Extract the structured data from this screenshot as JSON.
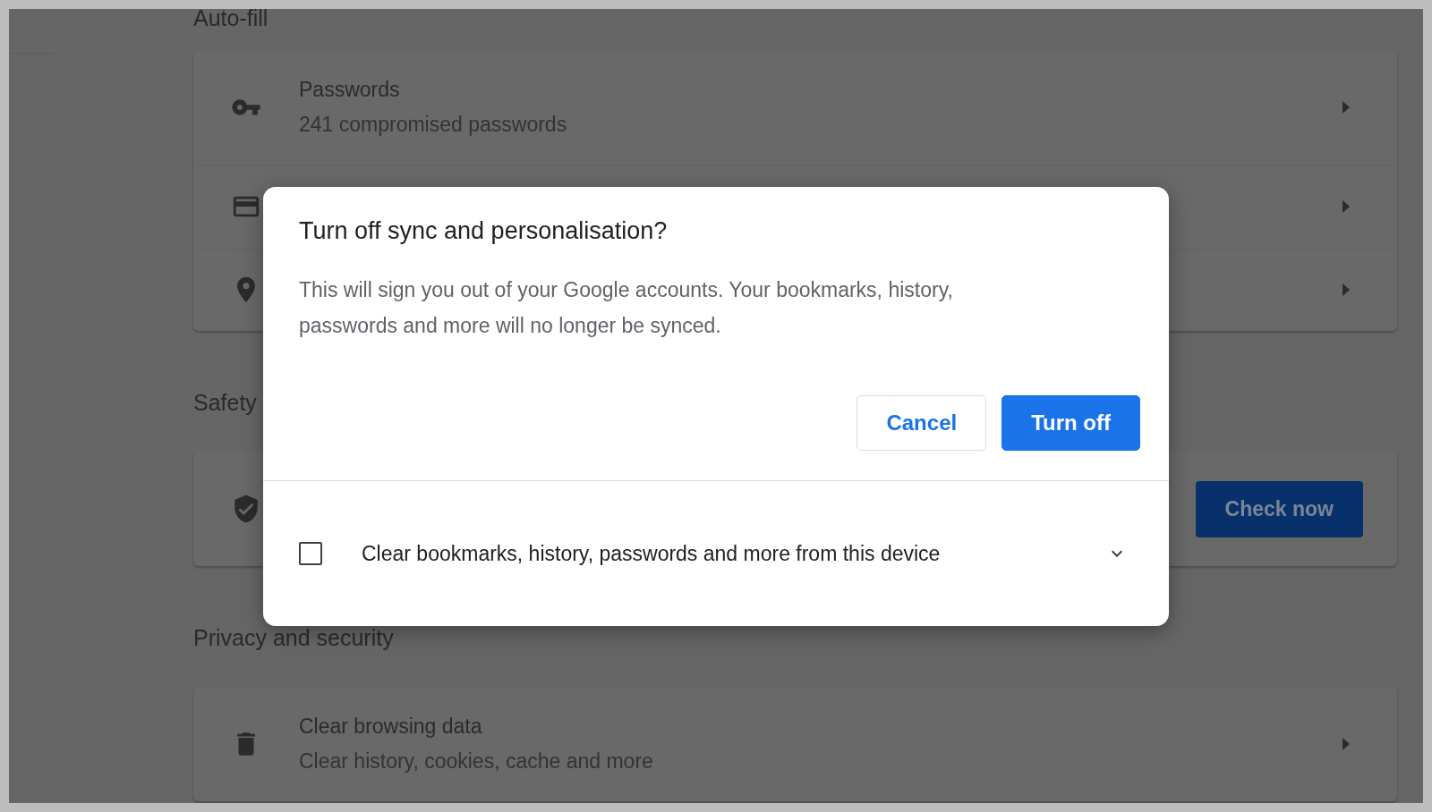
{
  "autofill": {
    "heading": "Auto-fill",
    "items": [
      {
        "kind": "key",
        "title": "Passwords",
        "subtitle": "241 compromised passwords"
      },
      {
        "kind": "card"
      },
      {
        "kind": "pin"
      }
    ]
  },
  "safety": {
    "heading": "Safety",
    "button": "Check now"
  },
  "privacy": {
    "heading": "Privacy and security",
    "items": [
      {
        "kind": "trash",
        "title": "Clear browsing data",
        "subtitle": "Clear history, cookies, cache and more"
      }
    ]
  },
  "dialog": {
    "title": "Turn off sync and personalisation?",
    "body": "This will sign you out of your Google accounts. Your bookmarks, history, passwords and more will no longer be synced.",
    "buttons": [
      {
        "label": "Cancel",
        "kind": "secondary"
      },
      {
        "label": "Turn off",
        "kind": "primary"
      }
    ],
    "checkbox": {
      "label": "Clear bookmarks, history, passwords and more from this device",
      "checked": false
    }
  }
}
